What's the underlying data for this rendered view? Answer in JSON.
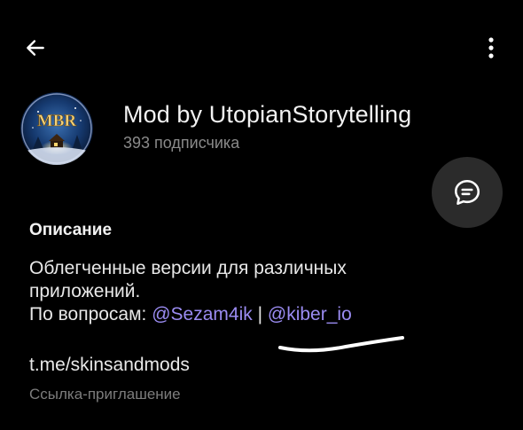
{
  "header": {
    "back_icon": "arrow-left-icon",
    "menu_icon": "more-vertical-icon"
  },
  "channel": {
    "avatar_text": "MBR",
    "name": "Mod by UtopianStorytelling",
    "subscribers": "393 подписчика"
  },
  "fab": {
    "icon": "chat-bubble-icon"
  },
  "description": {
    "title": "Описание",
    "line1": "Облегченные версии для различных",
    "line2": "приложений.",
    "contact_prefix": "По вопросам: ",
    "mention1": "@Sezam4ik",
    "separator": " | ",
    "mention2": "@kiber_io"
  },
  "invite": {
    "link": "t.me/skinsandmods",
    "caption": "Ссылка-приглашение"
  },
  "colors": {
    "background": "#000000",
    "mention": "#9b8cf2",
    "secondary_text": "#8a8a8a",
    "fab_bg": "#2b2b2b"
  }
}
